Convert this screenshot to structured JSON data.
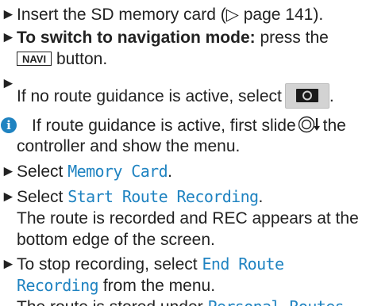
{
  "steps": [
    {
      "bullet": "►",
      "text_before": "Insert the SD memory card (",
      "page_ref_glyph": "▷",
      "text_after": " page 141)."
    },
    {
      "bullet": "►",
      "bold_text": "To switch to navigation mode:",
      "text_before_key": " press the",
      "key_label": "NAVI",
      "text_after_key": " button."
    },
    {
      "bullet": "►",
      "text": "If no route guidance is active, select",
      "button_icon": "camera-button-icon",
      "text_after": "."
    }
  ],
  "info_note": {
    "icon": "info-icon",
    "icon_glyph": "i",
    "text_before": "If route guidance is active, first slide",
    "controller_icon": "controller-slide-down-icon",
    "text_after": "the",
    "line2": "controller and show the menu."
  },
  "steps2": [
    {
      "bullet": "►",
      "text": "Select ",
      "menu_item": "Memory Card",
      "text_after": "."
    },
    {
      "bullet": "►",
      "text": "Select ",
      "menu_item": "Start Route Recording",
      "text_after": ".",
      "result_line1": "The route is recorded and REC appears at the",
      "result_line2": "bottom edge of the screen."
    },
    {
      "bullet": "►",
      "text": "To stop recording, select ",
      "menu_item_part1": "End Route",
      "menu_item_part2": "Recording",
      "text_after": " from the menu.",
      "result_before": "The route is stored under ",
      "result_menu_item": "Personal Routes",
      "result_after": "."
    }
  ],
  "colors": {
    "menu_item_blue": "#1f83c1",
    "text": "#222222",
    "button_gray": "#d3d3d3"
  }
}
